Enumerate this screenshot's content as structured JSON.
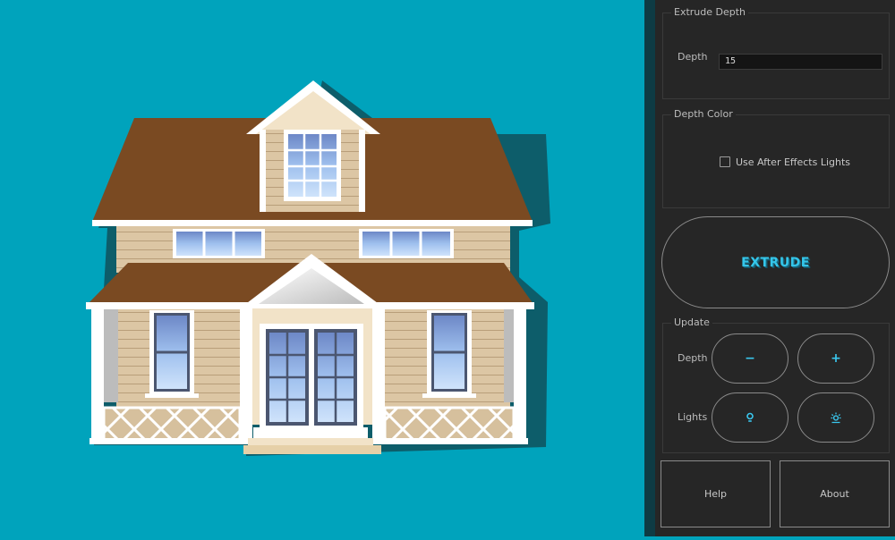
{
  "panel": {
    "extrude_depth": {
      "legend": "Extrude Depth",
      "depth_label": "Depth",
      "depth_value": "15"
    },
    "depth_color": {
      "legend": "Depth Color",
      "checkbox_label": "Use After Effects Lights",
      "checked": false
    },
    "extrude_button": "EXTRUDE",
    "update": {
      "legend": "Update",
      "depth_label": "Depth",
      "lights_label": "Lights",
      "depth_minus": "−",
      "depth_plus": "+",
      "lights_icons": [
        "lightbulb-icon",
        "sun-icon"
      ]
    },
    "help_button": "Help",
    "about_button": "About"
  },
  "colors": {
    "canvas_bg": "#00a3bc",
    "panel_bg": "#262626",
    "accent": "#34c6ea",
    "roof": "#7a4a22",
    "siding": "#dcc6a4",
    "trim": "#ffffff",
    "glass": "#9fc2ee",
    "shadow": "#0d5d6a"
  },
  "canvas": {
    "image": "house-illustration"
  }
}
